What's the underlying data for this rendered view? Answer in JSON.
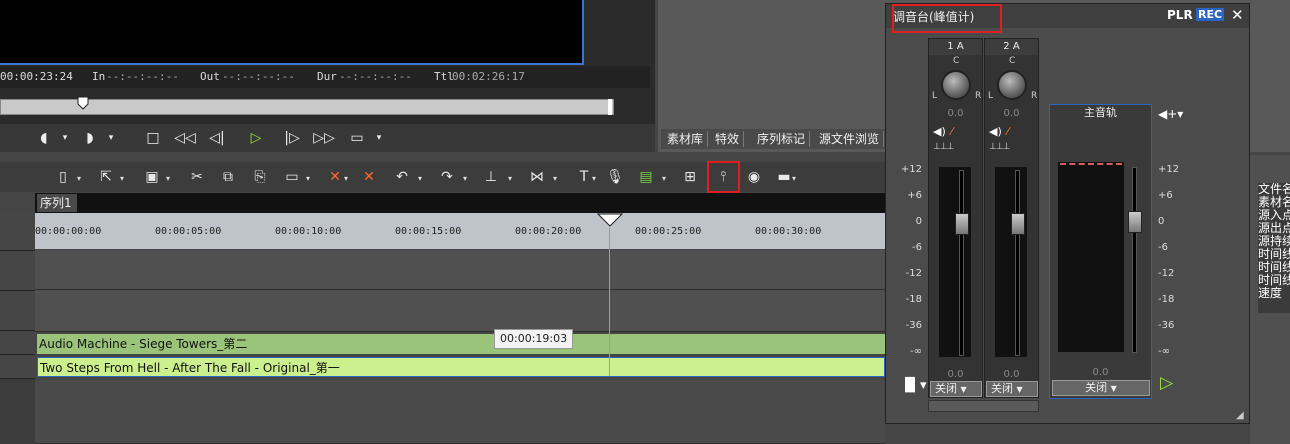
{
  "player": {
    "timecode_current": "00:00:23:24",
    "in_label": "In",
    "in_value": "--:--:--:--",
    "out_label": "Out",
    "out_value": "--:--:--:--",
    "dur_label": "Dur",
    "dur_value": "--:--:--:--",
    "ttl_label": "Ttl",
    "ttl_value": "00:02:26:17"
  },
  "bin_tabs": [
    "素材库",
    "特效",
    "序列标记",
    "源文件浏览"
  ],
  "sequence_tab": "序列1",
  "ruler_labels": [
    "00:00:00:00",
    "00:00:05:00",
    "00:00:10:00",
    "00:00:15:00",
    "00:00:20:00",
    "00:00:25:00",
    "00:00:30:00"
  ],
  "clips": [
    {
      "name": "Audio Machine - Siege Towers_第二",
      "color": "#9bc47b"
    },
    {
      "name": "Two Steps From Hell - After The Fall - Original_第一",
      "color": "#cdf08e"
    }
  ],
  "tooltip": "00:00:19:03",
  "mixer": {
    "title": "调音台(峰值计)",
    "plr": "PLR",
    "rec": "REC",
    "channels": [
      {
        "label": "1 A",
        "pan_value": "0.0",
        "fader_value": "0.0",
        "mode": "关闭"
      },
      {
        "label": "2 A",
        "pan_value": "0.0",
        "fader_value": "0.0",
        "mode": "关闭"
      }
    ],
    "master": {
      "label": "主音轨",
      "fader_value": "0.0",
      "mode": "关闭"
    },
    "scale_left": [
      "+12",
      "+6",
      "0",
      "-6",
      "-12",
      "-18",
      "-36",
      "-∞"
    ],
    "scale_right": [
      "+12",
      "+6",
      "0",
      "-6",
      "-12",
      "-18",
      "-36",
      "-∞"
    ],
    "pan_l": "L",
    "pan_c": "C",
    "pan_r": "R"
  },
  "right_list": [
    "文件名",
    "素材名",
    "源入点",
    "源出点",
    "源持续",
    "时间线",
    "时间线",
    "时间线",
    "速度"
  ]
}
